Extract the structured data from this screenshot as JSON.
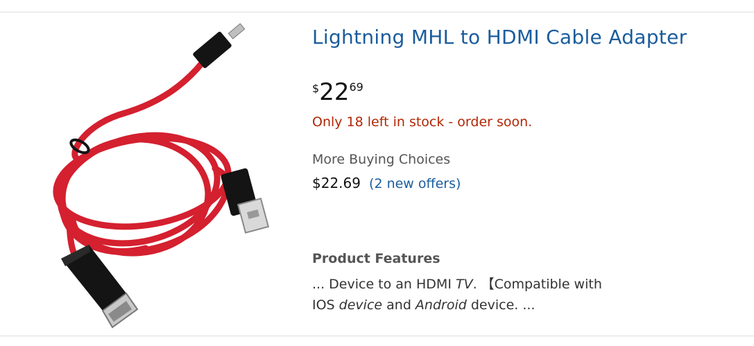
{
  "product": {
    "title": "Lightning MHL to HDMI Cable Adapter",
    "price": {
      "symbol": "$",
      "whole": "22",
      "fraction": "69"
    },
    "stock_message": "Only 18 left in stock - order soon.",
    "more_buying": {
      "label": "More Buying Choices",
      "price": "$22.69",
      "offers_link": "(2 new offers)"
    },
    "features": {
      "heading": "Product Features",
      "p1": "... Device to an HDMI ",
      "em1": "TV",
      "p2": ". 【Compatible with IOS ",
      "em2": "device",
      "p3": " and ",
      "em3": "Android",
      "p4": " device. ..."
    }
  },
  "colors": {
    "link": "#1a5c9c",
    "stock": "#b12704",
    "cable": "#d4202f",
    "connector": "#141414"
  },
  "image": {
    "subject": "red-cable-with-hdmi-usb-micro-usb-connectors"
  }
}
